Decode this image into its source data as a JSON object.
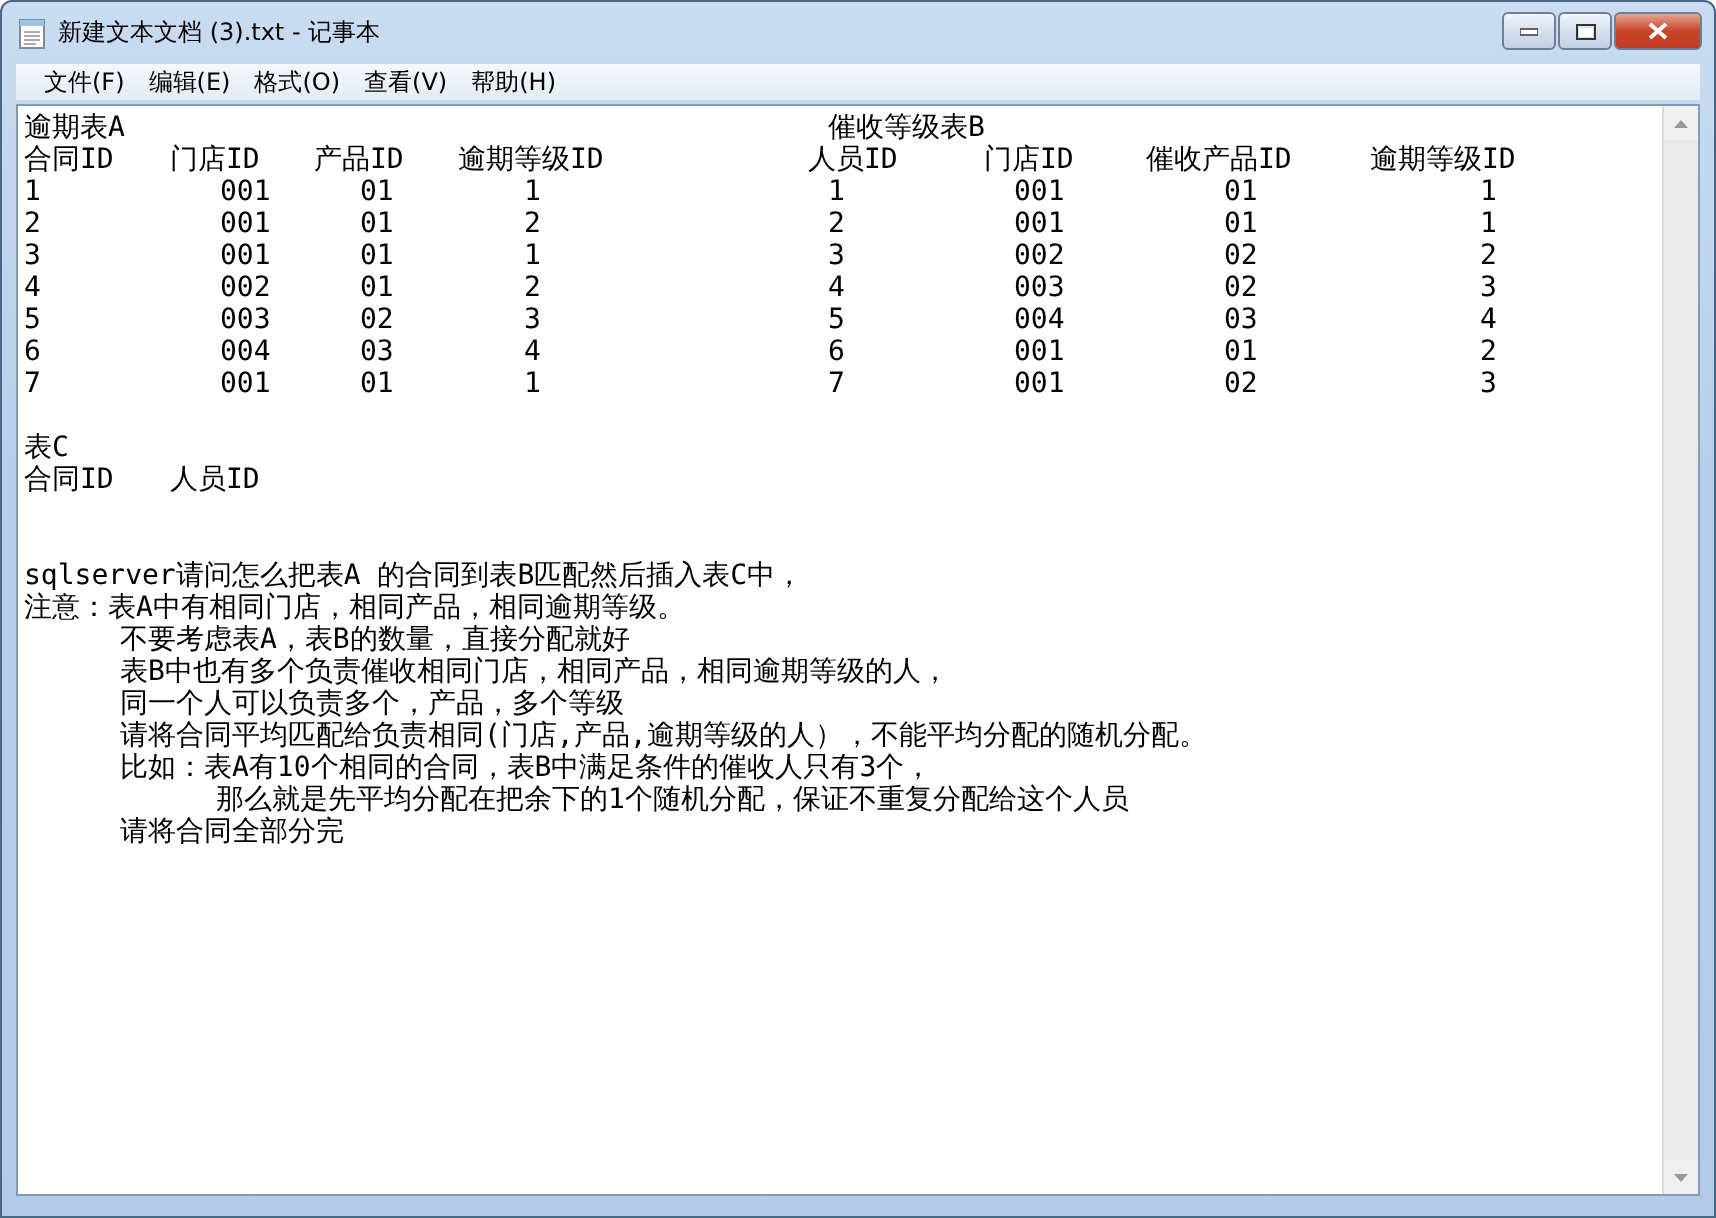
{
  "window": {
    "title": "新建文本文档 (3).txt - 记事本"
  },
  "menu": [
    "文件(F)",
    "编辑(E)",
    "格式(O)",
    "查看(V)",
    "帮助(H)"
  ],
  "table_a": {
    "title": "逾期表A",
    "columns": [
      "合同ID",
      "门店ID",
      "产品ID",
      "逾期等级ID"
    ],
    "rows": [
      [
        "1",
        "001",
        "01",
        "1"
      ],
      [
        "2",
        "001",
        "01",
        "2"
      ],
      [
        "3",
        "001",
        "01",
        "1"
      ],
      [
        "4",
        "002",
        "01",
        "2"
      ],
      [
        "5",
        "003",
        "02",
        "3"
      ],
      [
        "6",
        "004",
        "03",
        "4"
      ],
      [
        "7",
        "001",
        "01",
        "1"
      ]
    ]
  },
  "table_b": {
    "title": "催收等级表B",
    "columns": [
      "人员ID",
      "门店ID",
      "催收产品ID",
      "逾期等级ID"
    ],
    "rows": [
      [
        "1",
        "001",
        "01",
        "1"
      ],
      [
        "2",
        "001",
        "01",
        "1"
      ],
      [
        "3",
        "002",
        "02",
        "2"
      ],
      [
        "4",
        "003",
        "02",
        "3"
      ],
      [
        "5",
        "004",
        "03",
        "4"
      ],
      [
        "6",
        "001",
        "01",
        "2"
      ],
      [
        "7",
        "001",
        "02",
        "3"
      ]
    ]
  },
  "table_c": {
    "title": "表C",
    "columns": [
      "合同ID",
      "人员ID"
    ]
  },
  "notes": [
    {
      "text": "sqlserver请问怎么把表A 的合同到表B匹配然后插入表C中，"
    },
    {
      "text": "注意：表A中有相同门店，相同产品，相同逾期等级。",
      "children": [
        {
          "text": "不要考虑表A，表B的数量，直接分配就好"
        },
        {
          "text": "表B中也有多个负责催收相同门店，相同产品，相同逾期等级的人，"
        },
        {
          "text": "同一个人可以负责多个，产品，多个等级"
        },
        {
          "text": "请将合同平均匹配给负责相同(门店,产品,逾期等级的人），不能平均分配的随机分配。"
        },
        {
          "text": "比如：表A有10个相同的合同，表B中满足条件的催收人只有3个，",
          "children": [
            {
              "text": "那么就是先平均分配在把余下的1个随机分配，保证不重复分配给这个人员"
            }
          ]
        },
        {
          "text": "请将合同全部分完"
        }
      ]
    }
  ]
}
